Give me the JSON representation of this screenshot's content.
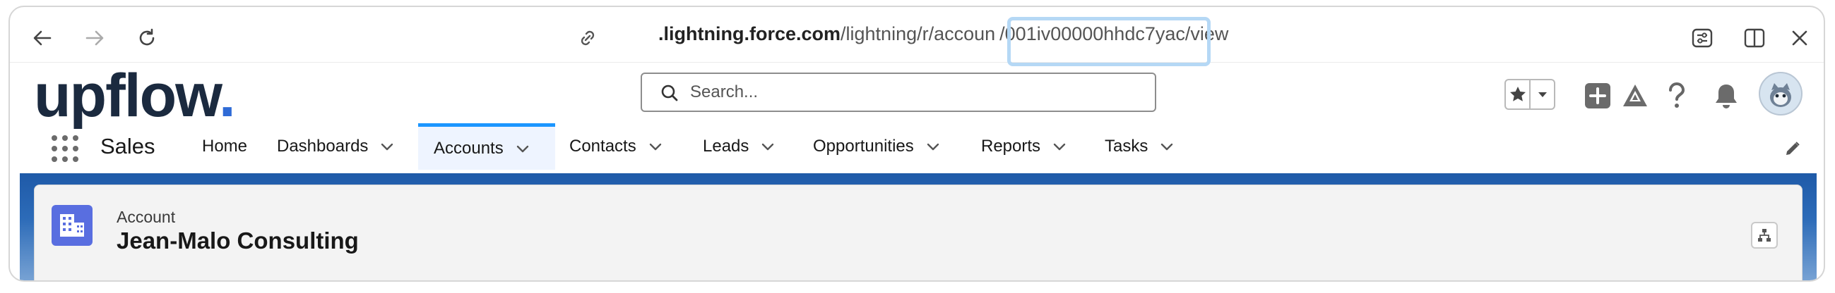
{
  "browser": {
    "url_host": ".lightning.force.com",
    "url_path_before": "/lightning/r/accoun",
    "url_highlight": "/001iv00000hhdc7yac/",
    "url_path_after": "view"
  },
  "header": {
    "logo_text": "upflow",
    "logo_dot": ".",
    "search_placeholder": "Search..."
  },
  "nav": {
    "app_name": "Sales",
    "items": [
      {
        "label": "Home"
      },
      {
        "label": "Dashboards"
      },
      {
        "label": "Accounts"
      },
      {
        "label": "Contacts"
      },
      {
        "label": "Leads"
      },
      {
        "label": "Opportunities"
      },
      {
        "label": "Reports"
      },
      {
        "label": "Tasks"
      }
    ]
  },
  "record": {
    "object_type": "Account",
    "name": "Jean-Malo Consulting"
  },
  "colors": {
    "accent": "#1b96ff",
    "object_icon": "#596ee0",
    "logo_dot": "#2f6bd6"
  }
}
